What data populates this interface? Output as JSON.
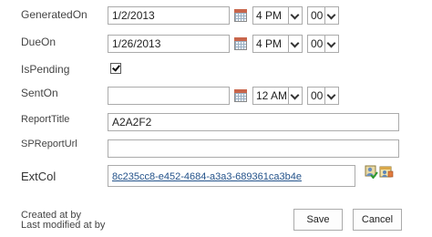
{
  "fields": {
    "generated_on": {
      "label": "GeneratedOn",
      "date": "1/2/2013",
      "hour": "4 PM",
      "minute": "00"
    },
    "due_on": {
      "label": "DueOn",
      "date": "1/26/2013",
      "hour": "4 PM",
      "minute": "00"
    },
    "is_pending": {
      "label": "IsPending",
      "checked": true
    },
    "sent_on": {
      "label": "SentOn",
      "date": "",
      "hour": "12 AM",
      "minute": "00"
    },
    "report_title": {
      "label": "ReportTitle",
      "value": "A2A2F2"
    },
    "sp_report_url": {
      "label": "SPReportUrl",
      "value": ""
    },
    "ext_col": {
      "label": "ExtCol",
      "value": "8c235cc8-e452-4684-a3a3-689361ca3b4e"
    }
  },
  "footer": {
    "created_at_by": "Created at by",
    "last_modified_at_by": "Last modified at by"
  },
  "buttons": {
    "save": "Save",
    "cancel": "Cancel"
  },
  "icons": {
    "date_picker": "calendar-icon",
    "select_arrow": "chevron-down-icon",
    "check_names": "check-names-icon",
    "browse": "browse-icon"
  },
  "colors": {
    "link": "#23528a",
    "calendar_header": "#c8664c",
    "border": "#ababab"
  }
}
